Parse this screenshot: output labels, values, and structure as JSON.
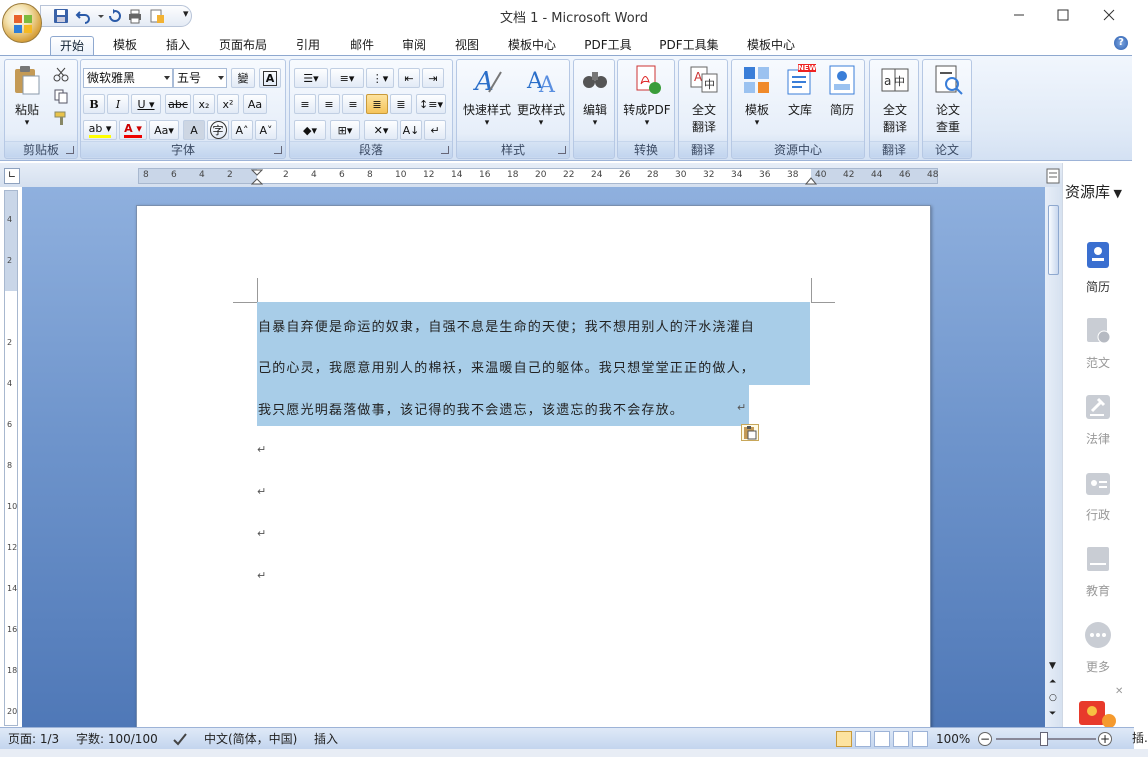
{
  "window": {
    "title": "文档 1 - Microsoft Word"
  },
  "tabs": [
    "开始",
    "模板",
    "插入",
    "页面布局",
    "引用",
    "邮件",
    "审阅",
    "视图",
    "模板中心",
    "PDF工具",
    "PDF工具集",
    "模板中心"
  ],
  "ribbon": {
    "clipboard": {
      "label": "剪贴板",
      "paste": "粘贴"
    },
    "font": {
      "label": "字体",
      "font_name": "微软雅黑",
      "font_size": "五号"
    },
    "paragraph": {
      "label": "段落"
    },
    "styles": {
      "label": "样式",
      "quick_styles": "快速样式",
      "change_styles": "更改样式"
    },
    "edit": {
      "label": "编辑"
    },
    "convert": {
      "label": "转换",
      "to_pdf": "转成PDF"
    },
    "translate1": {
      "label": "翻译",
      "full_text_1": "全文",
      "full_text_2": "翻译"
    },
    "resources": {
      "label": "资源中心",
      "template": "模板",
      "library": "文库",
      "resume": "简历",
      "new_badge": "NEW"
    },
    "translate2": {
      "label": "翻译",
      "full_text_1": "全文",
      "full_text_2": "翻译"
    },
    "thesis": {
      "label": "论文",
      "check_1": "论文",
      "check_2": "查重"
    }
  },
  "ruler": {
    "ticks": [
      "8",
      "6",
      "4",
      "2",
      "",
      "2",
      "4",
      "6",
      "8",
      "10",
      "12",
      "14",
      "16",
      "18",
      "20",
      "22",
      "24",
      "26",
      "28",
      "30",
      "32",
      "34",
      "36",
      "38",
      "40",
      "42",
      "44",
      "46",
      "48"
    ],
    "vticks": [
      "4",
      "2",
      "",
      "2",
      "4",
      "6",
      "8",
      "10",
      "12",
      "14",
      "16",
      "18",
      "20"
    ]
  },
  "document": {
    "lines": [
      "自暴自弃便是命运的奴隶，自强不息是生命的天使；我不想用别人的汗水浇灌自",
      "己的心灵，我愿意用别人的棉袄，来温暖自己的躯体。我只想堂堂正正的做人，",
      "我只愿光明磊落做事，该记得的我不会遗忘，该遗忘的我不会存放。"
    ],
    "para_mark": "↵"
  },
  "side_panel": {
    "title": "资源库",
    "items": [
      {
        "label": "简历",
        "active": true
      },
      {
        "label": "范文",
        "active": false
      },
      {
        "label": "法律",
        "active": false
      },
      {
        "label": "行政",
        "active": false
      },
      {
        "label": "教育",
        "active": false
      },
      {
        "label": "更多",
        "active": false
      }
    ]
  },
  "status": {
    "page": "页面: 1/3",
    "words": "字数: 100/100",
    "language": "中文(简体，中国)",
    "mode": "插入",
    "zoom": "100%",
    "extra": "插."
  },
  "colors": {
    "ribbon_bg": "#dde8f6",
    "selection": "#a8cde8",
    "canvas": "#6f95cc",
    "accent": "#2b579a"
  }
}
